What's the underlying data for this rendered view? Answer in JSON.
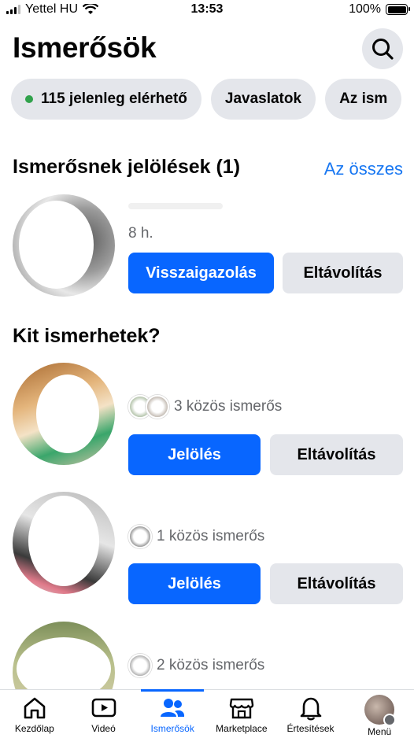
{
  "status_bar": {
    "carrier": "Yettel HU",
    "time": "13:53",
    "battery": "100%"
  },
  "header": {
    "title": "Ismerősök"
  },
  "chips": [
    {
      "label": "115 jelenleg elérhető"
    },
    {
      "label": "Javaslatok"
    },
    {
      "label": "Az ism"
    }
  ],
  "requests": {
    "title": "Ismerősnek jelölések (1)",
    "see_all": "Az összes",
    "items": [
      {
        "time": "8 h.",
        "confirm_label": "Visszaigazolás",
        "remove_label": "Eltávolítás"
      }
    ]
  },
  "suggestions": {
    "title": "Kit ismerhetek?",
    "items": [
      {
        "mutual": "3 közös ismerős",
        "add_label": "Jelölés",
        "remove_label": "Eltávolítás"
      },
      {
        "mutual": "1 közös ismerős",
        "add_label": "Jelölés",
        "remove_label": "Eltávolítás"
      },
      {
        "mutual": "2 közös ismerős"
      }
    ]
  },
  "tabbar": {
    "home": "Kezdőlap",
    "video": "Videó",
    "friends": "Ismerősök",
    "marketplace": "Marketplace",
    "notifications": "Értesítések",
    "menu": "Menü"
  },
  "colors": {
    "accent": "#0866ff",
    "online": "#31a24c",
    "link": "#1877f2"
  }
}
